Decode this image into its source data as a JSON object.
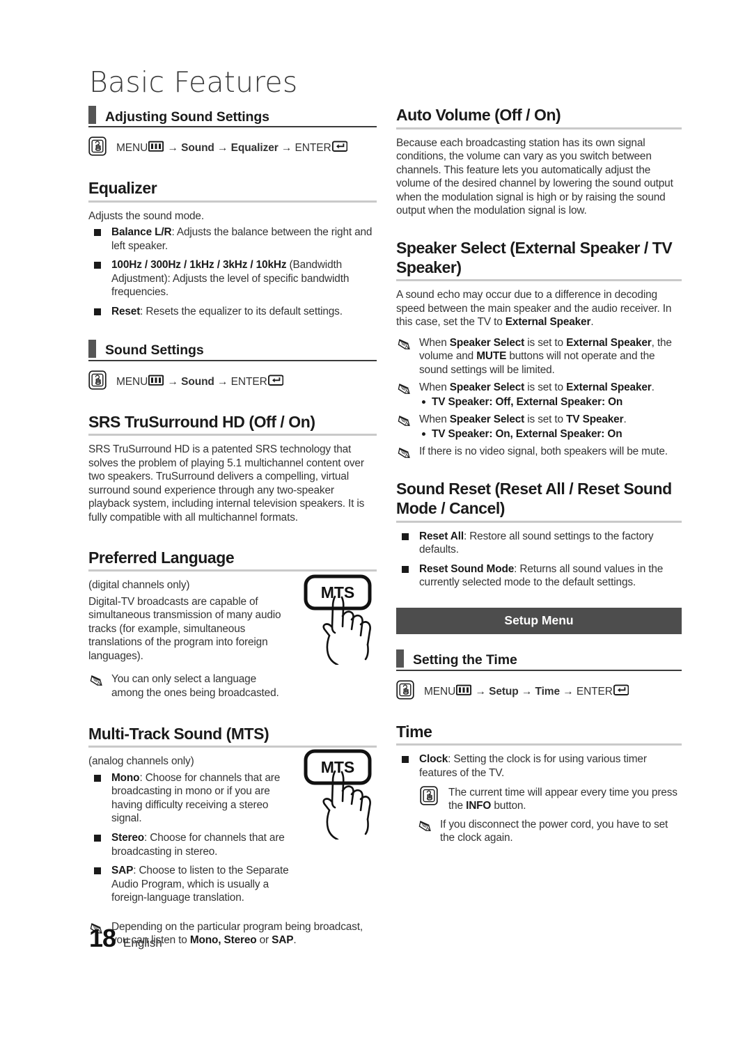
{
  "page": {
    "title": "Basic Features",
    "number": "18",
    "language": "English"
  },
  "left_column": {
    "section_adjusting_sound": {
      "heading": "Adjusting Sound Settings",
      "nav": {
        "menu": "MENU",
        "arrow": "→",
        "step1": "Sound",
        "step2": "Equalizer",
        "enter": "ENTER"
      }
    },
    "equalizer": {
      "heading": "Equalizer",
      "intro": "Adjusts the sound mode.",
      "bullets": [
        {
          "term": "Balance L/R",
          "text": ": Adjusts the balance between the right and left speaker."
        },
        {
          "term": "100Hz / 300Hz / 1kHz / 3kHz / 10kHz",
          "text": " (Bandwidth Adjustment): Adjusts the level of specific bandwidth frequencies."
        },
        {
          "term": "Reset",
          "text": ": Resets the equalizer to its default settings."
        }
      ]
    },
    "section_sound_settings": {
      "heading": "Sound Settings",
      "nav": {
        "menu": "MENU",
        "arrow": "→",
        "step1": "Sound",
        "enter": "ENTER"
      }
    },
    "srs": {
      "heading": "SRS TruSurround HD (Off / On)",
      "body": "SRS TruSurround HD is a patented SRS technology that solves the problem of playing 5.1 multichannel content over two speakers. TruSurround delivers a compelling, virtual surround sound experience through any two-speaker playback system, including internal television speakers. It is fully compatible with all multichannel formats."
    },
    "preferred_language": {
      "heading": "Preferred Language",
      "note_channels": "(digital channels only)",
      "body": "Digital-TV broadcasts are capable of simultaneous transmission of many audio tracks (for example, simultaneous translations of the program into foreign languages).",
      "notes": [
        "You can only select a language among the ones being broadcasted."
      ],
      "figure_label": "MTS"
    },
    "multi_track_sound": {
      "heading": "Multi-Track Sound (MTS)",
      "note_channels": "(analog channels only)",
      "bullets": [
        {
          "term": "Mono",
          "text": ": Choose for channels that are broadcasting in mono or if you are having difficulty receiving a stereo signal."
        },
        {
          "term": "Stereo",
          "text": ": Choose for channels that are broadcasting in stereo."
        },
        {
          "term": "SAP",
          "text": ": Choose to listen to the Separate Audio Program, which is usually a foreign-language translation."
        }
      ],
      "note_prefix": "Depending on the particular program being broadcast, you can listen to ",
      "note_bold": "Mono, Stereo",
      "note_mid": " or ",
      "note_bold2": "SAP",
      "note_suffix": ".",
      "figure_label": "MTS"
    }
  },
  "right_column": {
    "auto_volume": {
      "heading": "Auto Volume (Off / On)",
      "body": "Because each broadcasting station has its own signal conditions, the volume can vary as you switch between channels. This feature lets you automatically adjust the volume of the desired channel by lowering the sound output when the modulation signal is high or by raising the sound output when the modulation signal is low."
    },
    "speaker_select": {
      "heading": "Speaker Select (External Speaker / TV Speaker)",
      "body_pre": "A sound echo may occur due to a difference in decoding speed between the main speaker and the audio receiver. In this case, set the TV to ",
      "body_bold": "External Speaker",
      "body_post": ".",
      "note1": {
        "a": "When ",
        "b1": "Speaker Select",
        "c": " is set to ",
        "b2": "External Speaker",
        "d": ", the volume and ",
        "b3": "MUTE",
        "e": " buttons will not operate and the sound settings will be limited."
      },
      "note2": {
        "a": "When ",
        "b1": "Speaker Select",
        "c": " is set to ",
        "b2": "External Speaker",
        "d": "."
      },
      "sub2": "TV Speaker: Off, External Speaker: On",
      "note3": {
        "a": "When ",
        "b1": "Speaker Select",
        "c": " is set to ",
        "b2": "TV Speaker",
        "d": "."
      },
      "sub3": "TV Speaker: On, External Speaker: On",
      "note4": "If there is no video signal, both speakers will be mute."
    },
    "sound_reset": {
      "heading": "Sound Reset (Reset All / Reset Sound Mode / Cancel)",
      "bullets": [
        {
          "term": "Reset All",
          "text": ": Restore all sound settings to the factory defaults."
        },
        {
          "term": "Reset Sound Mode",
          "text": ": Returns all sound values in the currently selected mode to the default settings."
        }
      ]
    },
    "setup_banner": "Setup Menu",
    "section_setting_time": {
      "heading": "Setting the Time",
      "nav": {
        "menu": "MENU",
        "arrow": "→",
        "step1": "Setup",
        "step2": "Time",
        "enter": "ENTER"
      }
    },
    "time": {
      "heading": "Time",
      "bullets": [
        {
          "term": "Clock",
          "text": ": Setting the clock is for using various timer features of the TV."
        }
      ],
      "press_note": {
        "a": "The current time will appear every time you press the ",
        "b": "INFO",
        "c": " button."
      },
      "pencil_note": "If you disconnect the power cord, you have to set the clock again."
    }
  },
  "icons": {
    "hand_press": "hand-press-icon",
    "menu": "menu-bars-icon",
    "enter": "enter-return-icon",
    "pencil": "pencil-note-icon",
    "mts_button": "mts-remote-button-icon"
  }
}
